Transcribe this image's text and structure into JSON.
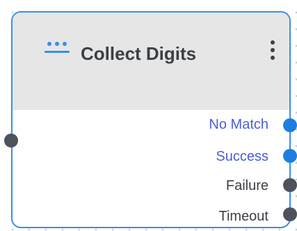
{
  "node": {
    "title": "Collect Digits",
    "type_icon": "dialpad-dots-icon",
    "menu_icon": "kebab-menu-icon",
    "accent_color": "#3a8ee6",
    "input_port": {
      "color": "#4d525c"
    },
    "outputs": [
      {
        "label": "No Match",
        "color": "#1e7ee0",
        "linked": true
      },
      {
        "label": "Success",
        "color": "#1e7ee0",
        "linked": true
      },
      {
        "label": "Failure",
        "color": "#4d525c",
        "linked": false
      },
      {
        "label": "Timeout",
        "color": "#4d525c",
        "linked": false
      }
    ]
  }
}
